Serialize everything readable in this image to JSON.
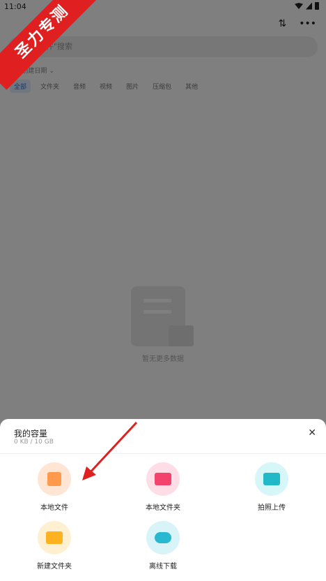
{
  "status": {
    "time": "11:04"
  },
  "search": {
    "placeholder": "云文件\"搜索"
  },
  "sort": {
    "label": "按创建日期"
  },
  "filters": [
    "全部",
    "文件夹",
    "音频",
    "视频",
    "图片",
    "压缩包",
    "其他"
  ],
  "empty": {
    "text": "暂无更多数据"
  },
  "watermark": {
    "text": "圣力专测"
  },
  "sheet": {
    "title": "我的容量",
    "subtitle": "0 KB / 10 GB",
    "actions": [
      {
        "label": "本地文件",
        "icon": "file-icon",
        "color": "#ff9a4d",
        "bg": "#ffe6d4"
      },
      {
        "label": "本地文件夹",
        "icon": "folder-icon",
        "color": "#f3436d",
        "bg": "#ffdde6"
      },
      {
        "label": "拍照上传",
        "icon": "camera-icon",
        "color": "#22b8c8",
        "bg": "#d6f6f8"
      },
      {
        "label": "新建文件夹",
        "icon": "new-folder-icon",
        "color": "#ffb21f",
        "bg": "#fff0d2"
      },
      {
        "label": "离线下载",
        "icon": "cloud-download-icon",
        "color": "#28b8d0",
        "bg": "#d8f4f8"
      }
    ]
  }
}
